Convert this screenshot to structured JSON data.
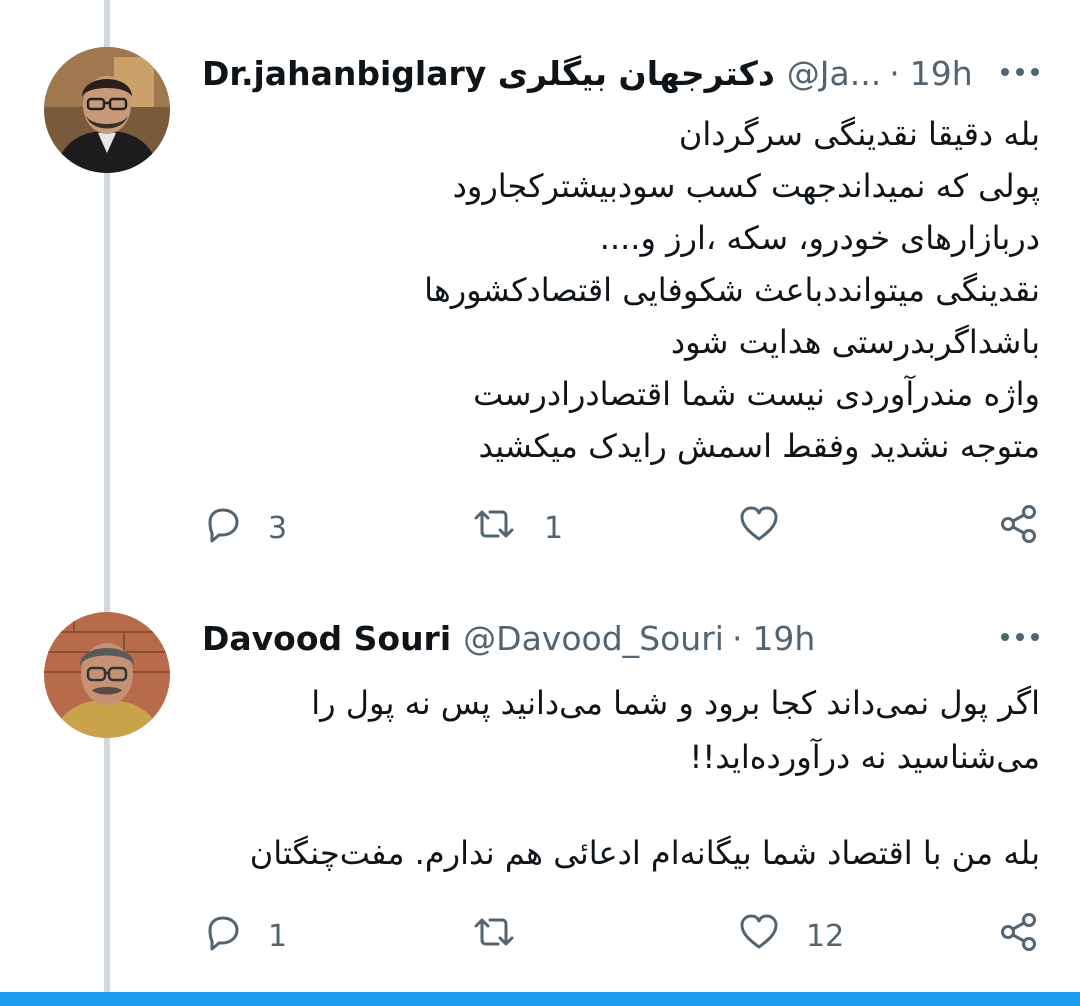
{
  "tweets": [
    {
      "display_name": "Dr.jahanbiglary دکترجهان بیگلری",
      "handle": "@Ja...",
      "separator": "·",
      "time": "19h",
      "body_lines": [
        "بله دقیقا نقدینگی سرگردان",
        "پولی که نمیداندجهت کسب سودبیشترکجارود",
        "دربازارهای خودرو، سکه ،ارز و....",
        "نقدینگی میتوانددباعث شکوفایی اقتصادکشورها",
        "باشداگربدرستی هدایت شود",
        "واژه مندرآوردی نیست شما اقتصادرادرست",
        "متوجه نشدید وفقط اسمش رایدک میکشید"
      ],
      "replies": "3",
      "retweets": "1",
      "likes": ""
    },
    {
      "display_name": "Davood Souri",
      "handle": "@Davood_Souri",
      "separator": "·",
      "time": "19h",
      "body_lines": [
        "اگر پول نمی‌داند کجا برود و شما می‌دانید پس نه پول را",
        "می‌شناسید نه درآورده‌اید!!"
      ],
      "body_lines_2": [
        "بله من با اقتصاد شما بیگانه‌ام ادعائی هم ندارم. مفت‌چنگتان"
      ],
      "replies": "1",
      "retweets": "",
      "likes": "12"
    }
  ],
  "icons": {
    "more": "more-dots-icon",
    "reply": "reply-bubble-icon",
    "retweet": "retweet-arrows-icon",
    "like": "heart-icon",
    "share": "share-icon"
  },
  "colors": {
    "text": "#0f1419",
    "secondary": "#536471",
    "thread_line": "#cfd9de",
    "accent": "#1d9bf0"
  }
}
